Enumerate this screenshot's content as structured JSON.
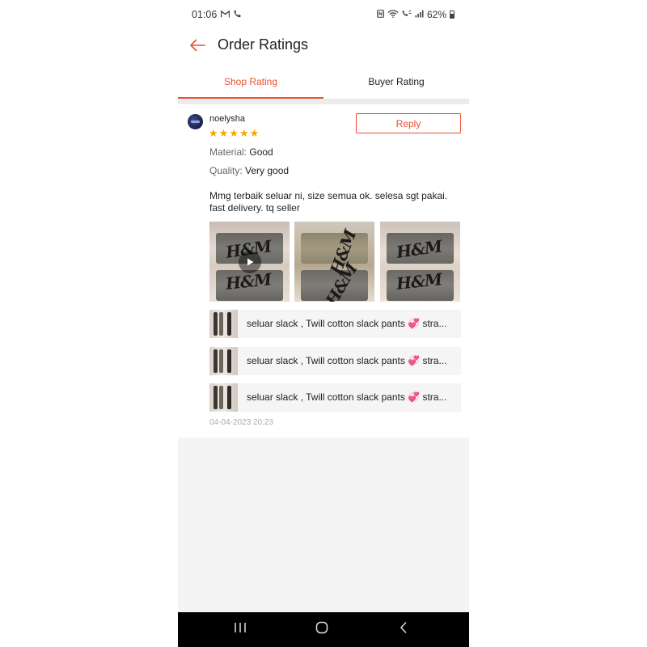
{
  "status_bar": {
    "time": "01:06",
    "battery": "62%",
    "icons": [
      "gmail-icon",
      "phone-call-icon",
      "nfc-icon",
      "wifi-call-icon",
      "volte-icon",
      "signal-icon",
      "battery-icon"
    ]
  },
  "header": {
    "title": "Order Ratings",
    "back_icon": "arrow-left-icon"
  },
  "tabs": [
    {
      "label": "Shop Rating",
      "active": true
    },
    {
      "label": "Buyer Rating",
      "active": false
    }
  ],
  "review": {
    "username": "noelysha",
    "stars": 5,
    "reply_label": "Reply",
    "material_label": "Material:",
    "material_value": "Good",
    "quality_label": "Quality:",
    "quality_value": "Very good",
    "comment": "Mmg terbaik seluar ni, size semua ok. selesa sgt pakai. fast delivery. tq seller",
    "media": [
      {
        "type": "video",
        "label": "H&M",
        "overlay_icon": "play-icon"
      },
      {
        "type": "image",
        "label": "H&M"
      },
      {
        "type": "image",
        "label": "H&M"
      }
    ],
    "products": [
      {
        "name": "seluar slack , Twill cotton slack pants 💞 stra..."
      },
      {
        "name": "seluar slack , Twill cotton slack pants 💞 stra..."
      },
      {
        "name": "seluar slack , Twill cotton slack pants 💞 stra..."
      }
    ],
    "timestamp": "04-04-2023 20:23"
  },
  "nav_bar": {
    "icons": [
      "recents-icon",
      "home-icon",
      "back-icon"
    ]
  },
  "colors": {
    "accent": "#ee4d2d",
    "star": "#f6a700",
    "background": "#f4f4f4"
  }
}
